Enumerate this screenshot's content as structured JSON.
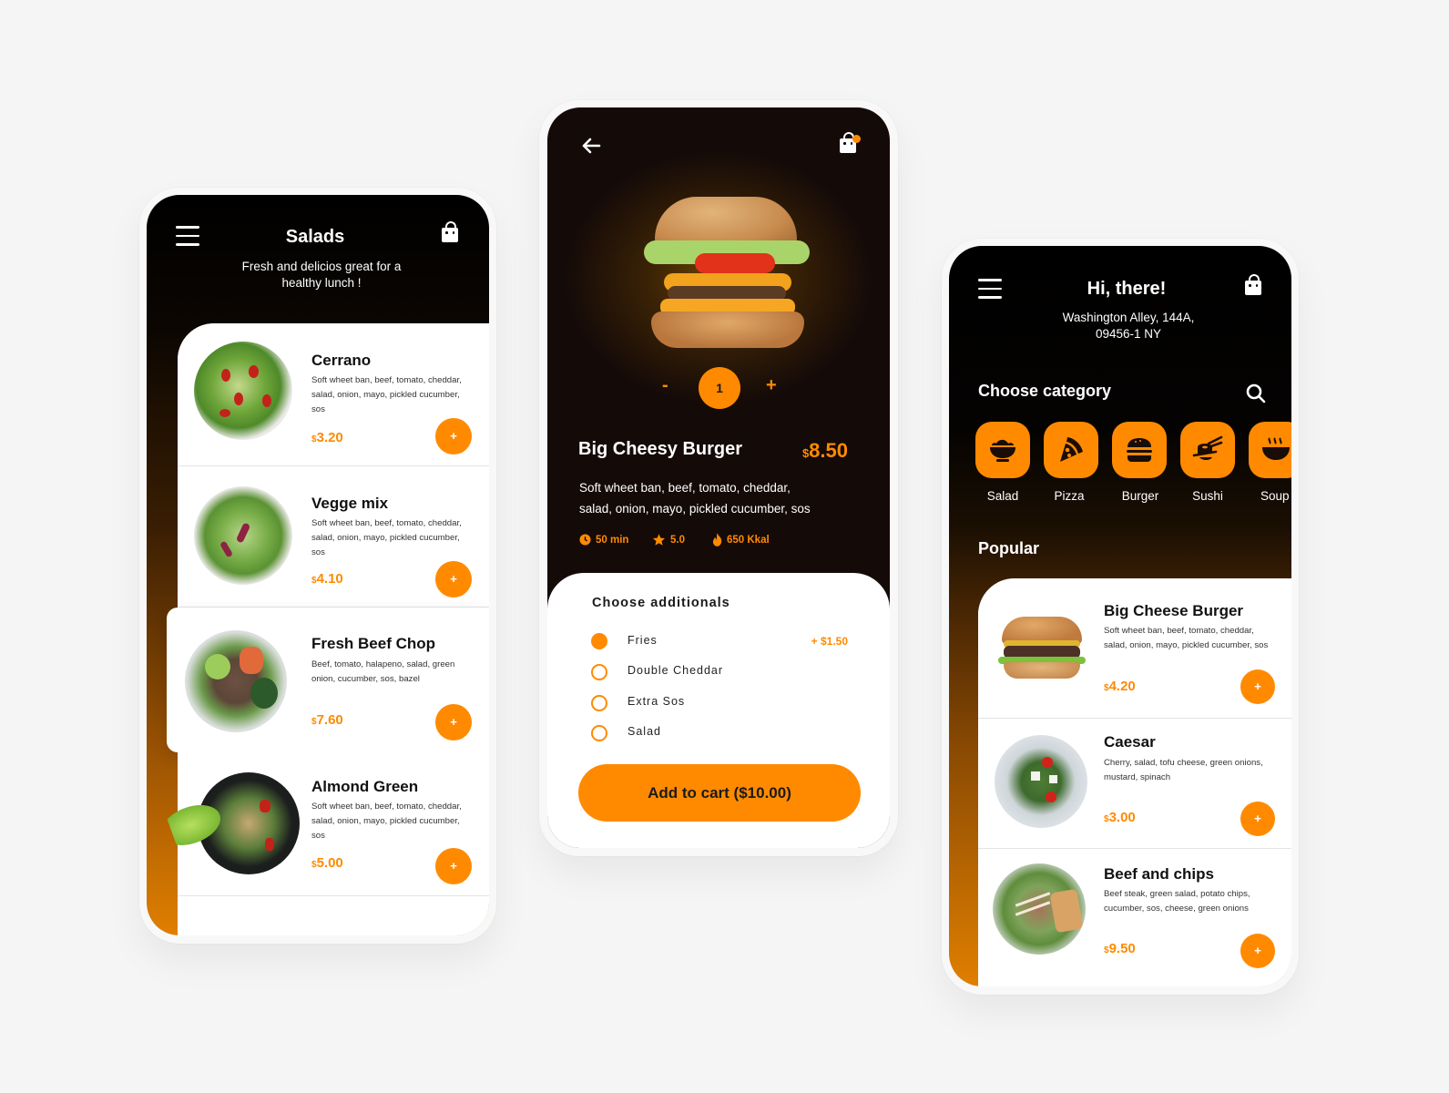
{
  "colors": {
    "accent": "#ff8a00",
    "dark": "#000000",
    "background": "#f5f5f5"
  },
  "salads_screen": {
    "menu_icon": "hamburger-icon",
    "cart_icon": "shopping-bag-icon",
    "title": "Salads",
    "subtitle_line1": "Fresh and delicios great for a",
    "subtitle_line2": "healthy lunch !",
    "items": [
      {
        "name": "Cerrano",
        "desc": "Soft wheet ban, beef, tomato, cheddar, salad, onion, mayo, pickled cucumber, sos",
        "currency": "$",
        "price": "3.20",
        "add": "+"
      },
      {
        "name": "Vegge mix",
        "desc": "Soft wheet ban, beef, tomato, cheddar, salad, onion, mayo, pickled cucumber, sos",
        "currency": "$",
        "price": "4.10",
        "add": "+"
      },
      {
        "name": "Fresh Beef Chop",
        "desc": "Beef, tomato, halapeno, salad, green onion,   cucumber, sos, bazel",
        "currency": "$",
        "price": "7.60",
        "add": "+"
      },
      {
        "name": "Almond Green",
        "desc": "Soft wheet ban, beef, tomato, cheddar, salad, onion, mayo, pickled cucumber, sos",
        "currency": "$",
        "price": "5.00",
        "add": "+"
      }
    ]
  },
  "detail_screen": {
    "back_icon": "arrow-left-icon",
    "cart_icon": "shopping-bag-icon",
    "quantity": {
      "minus": "-",
      "value": "1",
      "plus": "+"
    },
    "name": "Big Cheesy Burger",
    "currency": "$",
    "price": "8.50",
    "desc_line1": "Soft wheet ban, beef, tomato, cheddar,",
    "desc_line2": "salad, onion, mayo, pickled cucumber, sos",
    "meta": {
      "time": "50 min",
      "rating": "5.0",
      "calories": "650 Kkal"
    },
    "additionals_title": "Choose additionals",
    "additionals": [
      {
        "label": "Fries",
        "price": "+ $1.50",
        "selected": true
      },
      {
        "label": "Double Cheddar",
        "price": "",
        "selected": false
      },
      {
        "label": "Extra Sos",
        "price": "",
        "selected": false
      },
      {
        "label": "Salad",
        "price": "",
        "selected": false
      }
    ],
    "add_to_cart": "Add to cart ($10.00)"
  },
  "home_screen": {
    "menu_icon": "hamburger-icon",
    "cart_icon": "shopping-bag-icon",
    "greeting": "Hi, there!",
    "address_line1": "Washington Alley, 144A,",
    "address_line2": "09456-1 NY",
    "category_title": "Choose category",
    "search_icon": "search-icon",
    "categories": [
      {
        "label": "Salad",
        "icon": "salad-bowl-icon"
      },
      {
        "label": "Pizza",
        "icon": "pizza-slice-icon"
      },
      {
        "label": "Burger",
        "icon": "burger-icon"
      },
      {
        "label": "Sushi",
        "icon": "sushi-icon"
      },
      {
        "label": "Soup",
        "icon": "soup-bowl-icon"
      }
    ],
    "popular_title": "Popular",
    "popular": [
      {
        "name": "Big Cheese Burger",
        "desc": "Soft wheet ban, beef, tomato, cheddar, salad, onion, mayo, pickled cucumber, sos",
        "currency": "$",
        "price": "4.20",
        "add": "+"
      },
      {
        "name": "Caesar",
        "desc": "Cherry, salad, tofu cheese, green onions, mustard, spinach",
        "currency": "$",
        "price": "3.00",
        "add": "+"
      },
      {
        "name": "Beef and chips",
        "desc": "Beef steak, green salad, potato chips, cucumber, sos, cheese, green onions",
        "currency": "$",
        "price": "9.50",
        "add": "+"
      }
    ]
  }
}
